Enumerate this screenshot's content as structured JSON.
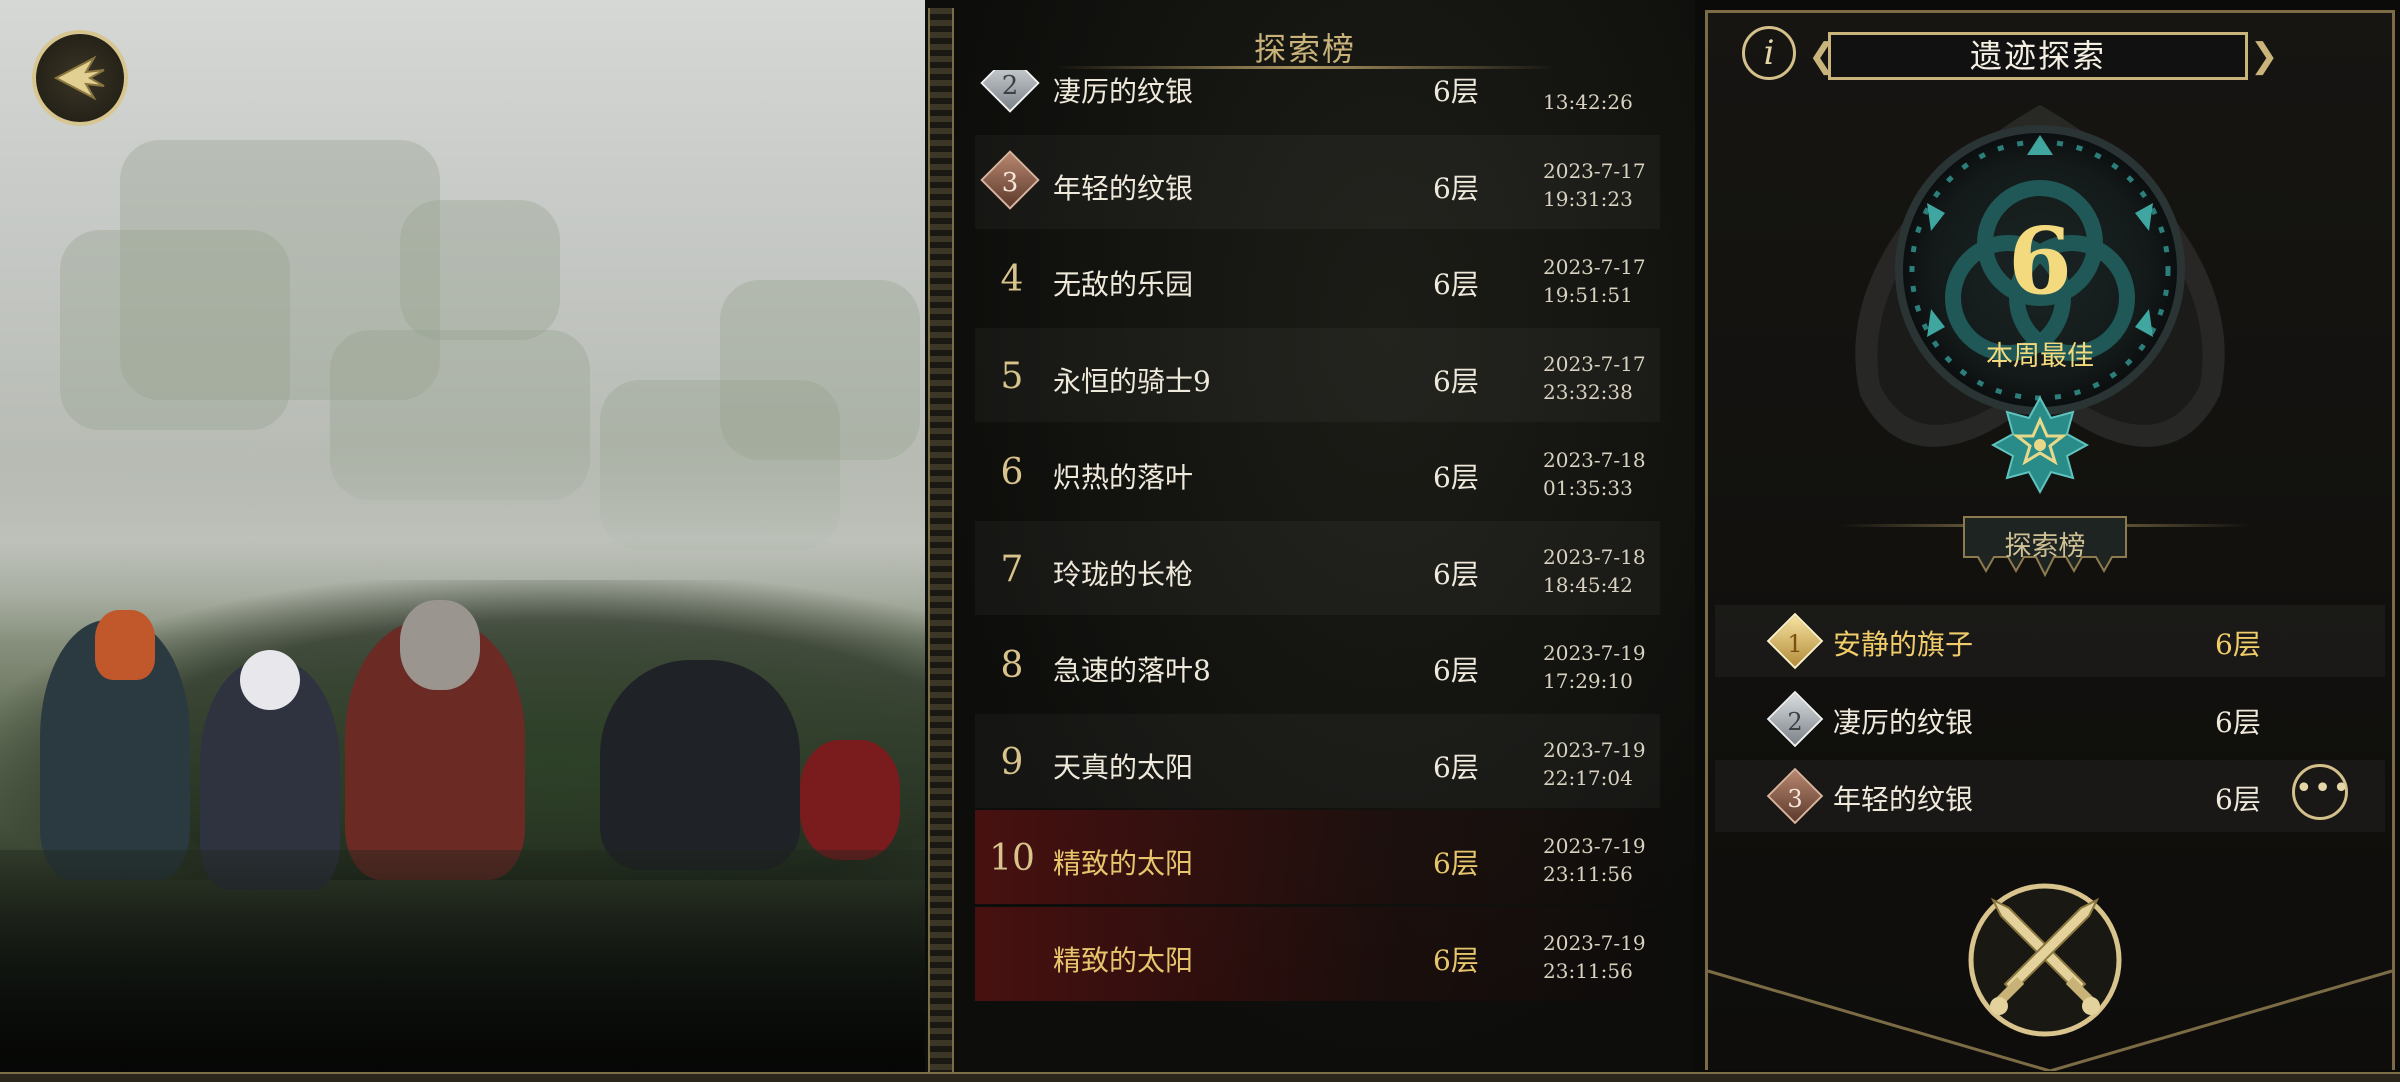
{
  "leaderboard_title": "探索榜",
  "leaderboard_rows": [
    {
      "rank": "2",
      "medal": "silver",
      "name": "凄厉的纹银",
      "floors": "6层",
      "date": "",
      "time": "13:42:26"
    },
    {
      "rank": "3",
      "medal": "bronze",
      "name": "年轻的纹银",
      "floors": "6层",
      "date": "2023-7-17",
      "time": "19:31:23"
    },
    {
      "rank": "4",
      "medal": "",
      "name": "无敌的乐园",
      "floors": "6层",
      "date": "2023-7-17",
      "time": "19:51:51"
    },
    {
      "rank": "5",
      "medal": "",
      "name": "永恒的骑士9",
      "floors": "6层",
      "date": "2023-7-17",
      "time": "23:32:38"
    },
    {
      "rank": "6",
      "medal": "",
      "name": "炽热的落叶",
      "floors": "6层",
      "date": "2023-7-18",
      "time": "01:35:33"
    },
    {
      "rank": "7",
      "medal": "",
      "name": "玲珑的长枪",
      "floors": "6层",
      "date": "2023-7-18",
      "time": "18:45:42"
    },
    {
      "rank": "8",
      "medal": "",
      "name": "急速的落叶8",
      "floors": "6层",
      "date": "2023-7-19",
      "time": "17:29:10"
    },
    {
      "rank": "9",
      "medal": "",
      "name": "天真的太阳",
      "floors": "6层",
      "date": "2023-7-19",
      "time": "22:17:04"
    },
    {
      "rank": "10",
      "medal": "",
      "name": "精致的太阳",
      "floors": "6层",
      "date": "2023-7-19",
      "time": "23:11:56"
    },
    {
      "rank": "",
      "medal": "",
      "name": "精致的太阳",
      "floors": "6层",
      "date": "2023-7-19",
      "time": "23:11:56",
      "is_self": true
    }
  ],
  "panel": {
    "info_icon_glyph": "i",
    "title": "遗迹探索",
    "chevron_left": "❮",
    "chevron_right": "❯",
    "best_value": "6",
    "best_label": "本周最佳",
    "leaderboard_title": "探索榜",
    "top3": [
      {
        "rank": "1",
        "medal": "gold",
        "name": "安静的旗子",
        "floors": "6层"
      },
      {
        "rank": "2",
        "medal": "silver",
        "name": "凄厉的纹银",
        "floors": "6层"
      },
      {
        "rank": "3",
        "medal": "bronze",
        "name": "年轻的纹银",
        "floors": "6层"
      }
    ],
    "more_glyph": "•••"
  },
  "colors": {
    "gold_text": "#f0cc6a",
    "accent_border": "#c9b47c",
    "teal": "#2e8f8c",
    "self_row_red": "#781414"
  },
  "icons": {
    "back": "back-arrow-icon",
    "info": "info-icon",
    "more": "more-icon",
    "battle": "crossed-swords-icon",
    "badge": "star-badge-icon"
  }
}
